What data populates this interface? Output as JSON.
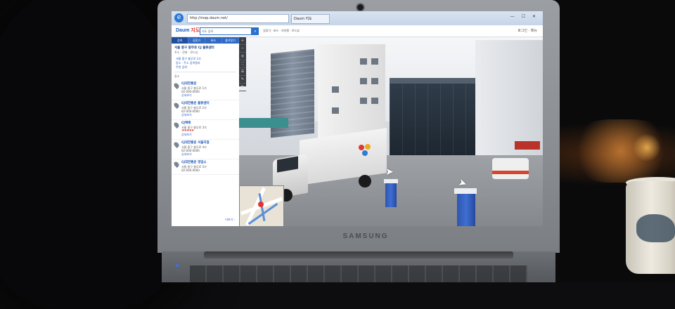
{
  "scene": {
    "laptop_brand": "SAMSUNG"
  },
  "browser": {
    "address": "http://map.daum.net/",
    "tab_label": "Daum 지도",
    "window_controls": "— ☐ ✕"
  },
  "site": {
    "logo_main": "Daum",
    "logo_sub": "지도",
    "search_placeholder": "지도 검색",
    "search_button": "⌕",
    "util_links": "길찾기 · 버스 · 지하철 · 로드뷰",
    "top_right": "로그인 · 메뉴"
  },
  "sidebar": {
    "tabs": [
      "검색",
      "길찾기",
      "버스",
      "즐겨찾기"
    ],
    "heading": "서울 중구 충무로 CJ 물류센터",
    "subheading": "주소 · 전화 · 로드뷰",
    "links": [
      "서울 중구 충무로 1가",
      "장소 · 주소 검색결과",
      "주변 검색"
    ],
    "section_label": "장소",
    "results": [
      {
        "title": "CJ대한통운",
        "lines": [
          "서울 중구 충무로 1가",
          "02-000-0000"
        ],
        "stars": "",
        "link": "상세보기"
      },
      {
        "title": "CJ대한통운 물류센터",
        "lines": [
          "서울 중구 충무로 2가",
          "02-000-0000"
        ],
        "stars": "",
        "link": "상세보기"
      },
      {
        "title": "CJ택배",
        "lines": [
          "서울 중구 충무로 3가",
          "02-000-0000"
        ],
        "stars": "★★★★★",
        "link": "상세보기"
      },
      {
        "title": "CJ대한통운 서울지점",
        "lines": [
          "서울 중구 충무로 4가",
          "02-000-0000"
        ],
        "stars": "",
        "link": "상세보기"
      },
      {
        "title": "CJ대한통운 영업소",
        "lines": [
          "서울 중구 충무로 5가",
          "02-000-0000"
        ],
        "stars": "",
        "link": "상세보기"
      }
    ],
    "more": "더보기 ›"
  },
  "tool_rail": [
    "+",
    "−",
    "◎",
    "⛶",
    "☰",
    "✎",
    "⚙"
  ],
  "street_view": {
    "truck_logo_colors": [
      "#e03a2f",
      "#f2a81d",
      "#2f7bd6"
    ]
  },
  "colors": {
    "accent": "#2f69c4",
    "link": "#2a5dbb",
    "bollard": "#3f6ed1"
  }
}
